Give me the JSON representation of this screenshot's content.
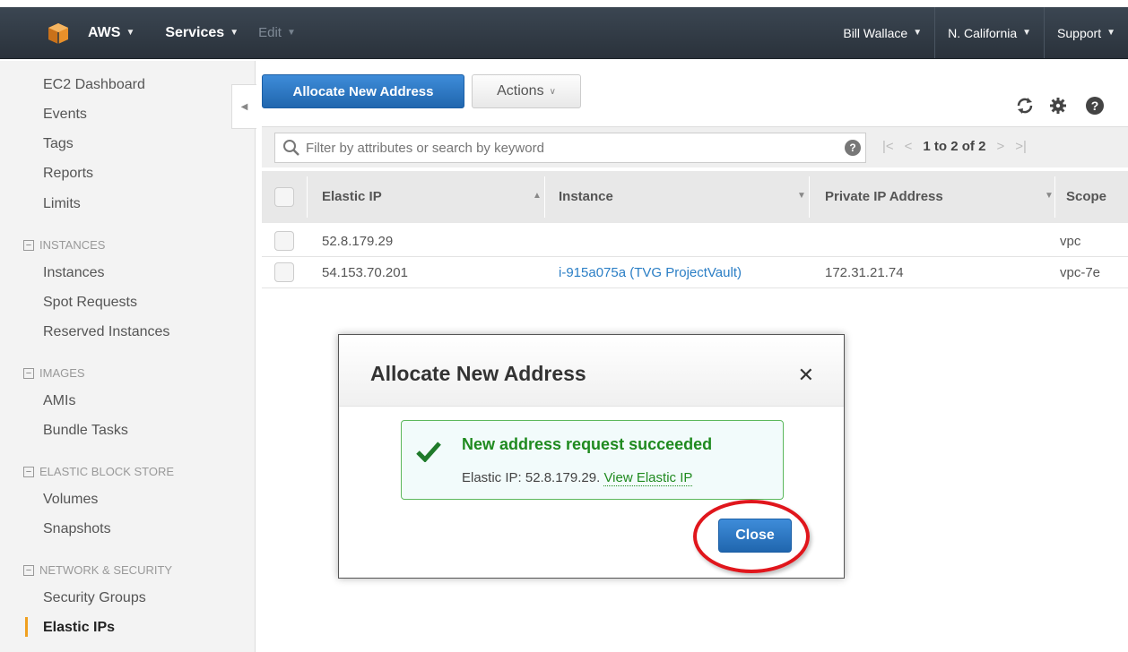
{
  "nav": {
    "aws": "AWS",
    "services": "Services",
    "edit": "Edit",
    "user": "Bill Wallace",
    "region": "N. California",
    "support": "Support"
  },
  "sidebar": {
    "top_links": [
      "EC2 Dashboard",
      "Events",
      "Tags",
      "Reports",
      "Limits"
    ],
    "sections": [
      {
        "title": "INSTANCES",
        "items": [
          "Instances",
          "Spot Requests",
          "Reserved Instances"
        ]
      },
      {
        "title": "IMAGES",
        "items": [
          "AMIs",
          "Bundle Tasks"
        ]
      },
      {
        "title": "ELASTIC BLOCK STORE",
        "items": [
          "Volumes",
          "Snapshots"
        ]
      },
      {
        "title": "NETWORK & SECURITY",
        "items": [
          "Security Groups",
          "Elastic IPs"
        ]
      }
    ],
    "active_item": "Elastic IPs"
  },
  "toolbar": {
    "allocate_label": "Allocate New Address",
    "actions_label": "Actions",
    "icons": [
      "refresh-icon",
      "gear-icon",
      "help-icon"
    ]
  },
  "filter": {
    "placeholder": "Filter by attributes or search by keyword",
    "pager_text": "1 to 2 of 2"
  },
  "table": {
    "columns": [
      "Elastic IP",
      "Instance",
      "Private IP Address",
      "Scope"
    ],
    "rows": [
      {
        "elastic_ip": "52.8.179.29",
        "instance": "",
        "private_ip": "",
        "scope": "vpc"
      },
      {
        "elastic_ip": "54.153.70.201",
        "instance": "i-915a075a (TVG ProjectVault)",
        "private_ip": "172.31.21.74",
        "scope": "vpc-7e"
      }
    ]
  },
  "modal": {
    "title": "Allocate New Address",
    "alert_title": "New address request succeeded",
    "alert_body": "Elastic IP: 52.8.179.29.",
    "alert_link": "View Elastic IP",
    "close_label": "Close"
  },
  "colors": {
    "nav_bg": "#2f3841",
    "primary_button": "#2b78c5",
    "success_green": "#1f8a1f",
    "highlight_ring": "#e0161c",
    "active_marker": "#f0a020"
  }
}
